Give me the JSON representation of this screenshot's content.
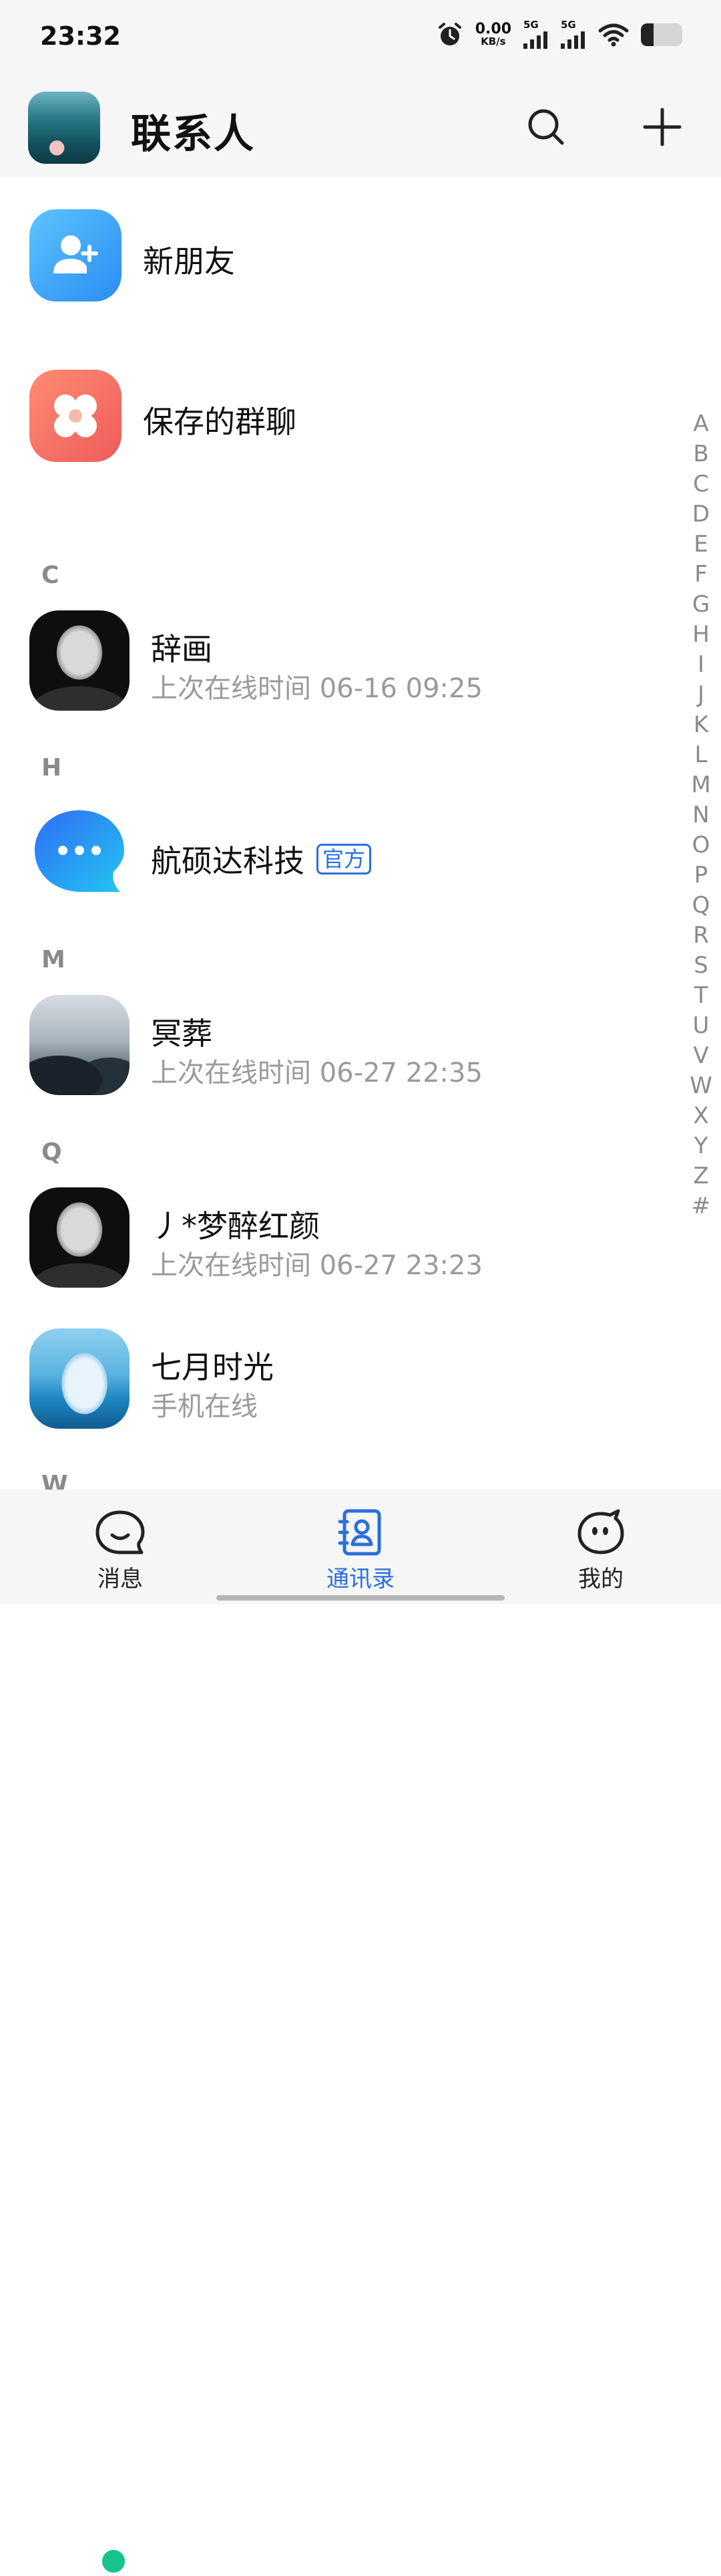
{
  "status_bar": {
    "time": "23:32",
    "net_speed_value": "0.00",
    "net_speed_unit": "KB/s",
    "signal1_label": "5G",
    "signal2_label": "5G",
    "battery_level": 0.3
  },
  "header": {
    "title": "联系人"
  },
  "functions": [
    {
      "label": "新朋友",
      "icon": "add-friend-icon",
      "color": "#3d9cf5"
    },
    {
      "label": "保存的群聊",
      "icon": "group-chat-icon",
      "color": "#f36f5f"
    }
  ],
  "sections": {
    "c": "C",
    "h": "H",
    "m": "M",
    "q": "Q",
    "w": "W"
  },
  "contacts": [
    {
      "name": "辞画",
      "status": "上次在线时间 06-16 09:25"
    },
    {
      "name": "航硕达科技",
      "badge": "官方"
    },
    {
      "name": "冥葬",
      "status": "上次在线时间 06-27 22:35"
    },
    {
      "name": "丿*梦醉红颜",
      "status": "上次在线时间 06-27 23:23"
    },
    {
      "name": "七月时光",
      "status": "手机在线",
      "online_color": "#17c28d"
    }
  ],
  "index": [
    "A",
    "B",
    "C",
    "D",
    "E",
    "F",
    "G",
    "H",
    "I",
    "J",
    "K",
    "L",
    "M",
    "N",
    "O",
    "P",
    "Q",
    "R",
    "S",
    "T",
    "U",
    "V",
    "W",
    "X",
    "Y",
    "Z",
    "#"
  ],
  "nav": {
    "messages": "消息",
    "contacts": "通讯录",
    "me": "我的",
    "active_color": "#2a6fdc"
  }
}
